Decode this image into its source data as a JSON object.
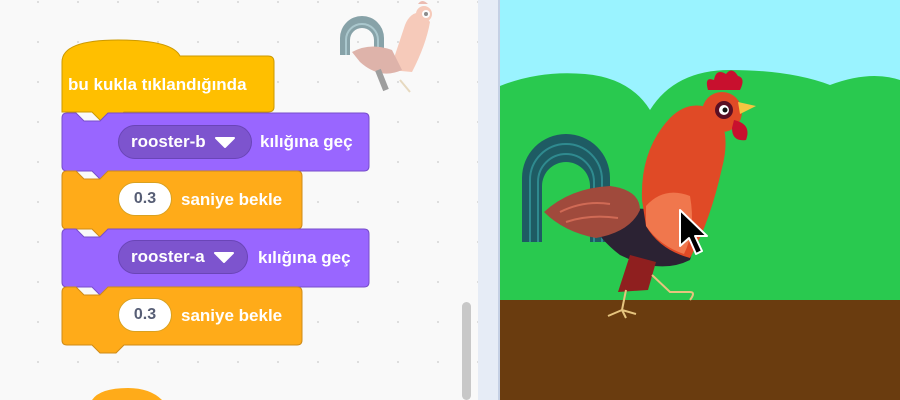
{
  "code": {
    "hat_label": "bu kukla tıklandığında",
    "blocks": [
      {
        "costume": "rooster-b",
        "label": "kılığına geç"
      },
      {
        "seconds": "0.3",
        "label": "saniye bekle"
      },
      {
        "costume": "rooster-a",
        "label": "kılığına geç"
      },
      {
        "seconds": "0.3",
        "label": "saniye bekle"
      }
    ]
  },
  "colors": {
    "events": "#ffbf00",
    "control": "#ffab19",
    "looks": "#9966ff",
    "sky": "#9af3ff",
    "hills": "#29c94f",
    "ground": "#6a3c0f",
    "rooster_red": "#e04a26"
  },
  "icons": {
    "sprite_thumb": "rooster-icon",
    "dropdown": "caret-down-icon",
    "cursor": "mouse-pointer-icon"
  }
}
